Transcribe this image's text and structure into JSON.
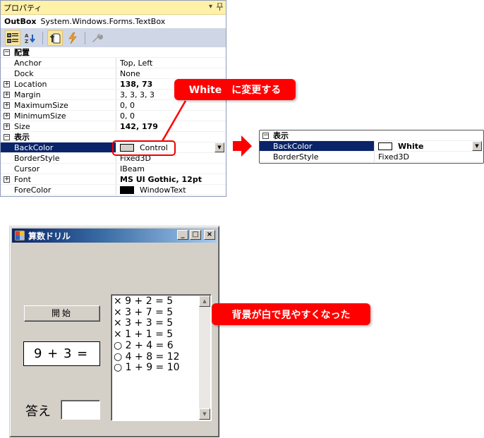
{
  "properties_panel": {
    "title": "プロパティ",
    "title_controls": [
      "▾",
      "⊥"
    ],
    "object_name": "OutBox",
    "object_type": "System.Windows.Forms.TextBox",
    "toolbar": {
      "categorized": "categorized-view",
      "alphabetical": "alphabetical-view",
      "properties": "properties-view",
      "events": "events-view",
      "property_pages": "property-pages"
    },
    "categories": [
      {
        "name": "配置",
        "expanded": true,
        "rows": [
          {
            "name": "Anchor",
            "value": "Top, Left",
            "bold": false,
            "expandable": false
          },
          {
            "name": "Dock",
            "value": "None",
            "bold": false,
            "expandable": false
          },
          {
            "name": "Location",
            "value": "138, 73",
            "bold": true,
            "expandable": true
          },
          {
            "name": "Margin",
            "value": "3, 3, 3, 3",
            "bold": false,
            "expandable": true
          },
          {
            "name": "MaximumSize",
            "value": "0, 0",
            "bold": false,
            "expandable": true
          },
          {
            "name": "MinimumSize",
            "value": "0, 0",
            "bold": false,
            "expandable": true
          },
          {
            "name": "Size",
            "value": "142, 179",
            "bold": true,
            "expandable": true
          }
        ]
      },
      {
        "name": "表示",
        "expanded": true,
        "rows": [
          {
            "name": "BackColor",
            "value": "Control",
            "bold": false,
            "expandable": false,
            "swatch": "#d4d0c8",
            "selected": true
          },
          {
            "name": "BorderStyle",
            "value": "Fixed3D",
            "bold": false,
            "expandable": false
          },
          {
            "name": "Cursor",
            "value": "IBeam",
            "bold": false,
            "expandable": false
          },
          {
            "name": "Font",
            "value": "MS UI Gothic, 12pt",
            "bold": true,
            "expandable": true
          },
          {
            "name": "ForeColor",
            "value": "WindowText",
            "bold": false,
            "expandable": false,
            "swatch": "#000000"
          }
        ]
      }
    ]
  },
  "callouts": {
    "top": "White　に変更する",
    "bottom": "背景が白で見やすくなった"
  },
  "snippet": {
    "category": "表示",
    "rows": [
      {
        "name": "BackColor",
        "value": "White",
        "swatch": "#ffffff",
        "bold": true,
        "selected": true
      },
      {
        "name": "BorderStyle",
        "value": "Fixed3D",
        "bold": false
      }
    ]
  },
  "form_window": {
    "title": "算数ドリル",
    "minimize": "_",
    "maximize": "□",
    "close": "×",
    "start_button": "開始",
    "question": "9 + 3 =",
    "answer_label": "答え",
    "answer_value": "",
    "history": [
      "× 9 + 2 = 5",
      "× 3 + 7 = 5",
      "× 3 + 3 = 5",
      "× 1 + 1 = 5",
      "○ 2 + 4 = 6",
      "○ 4 + 8 = 12",
      "○ 1 + 9 = 10"
    ]
  },
  "colors": {
    "accent_red": "#ff0000",
    "selection_blue": "#0a246a",
    "panel_title": "#fff1a8",
    "control_gray": "#d4d0c8"
  }
}
